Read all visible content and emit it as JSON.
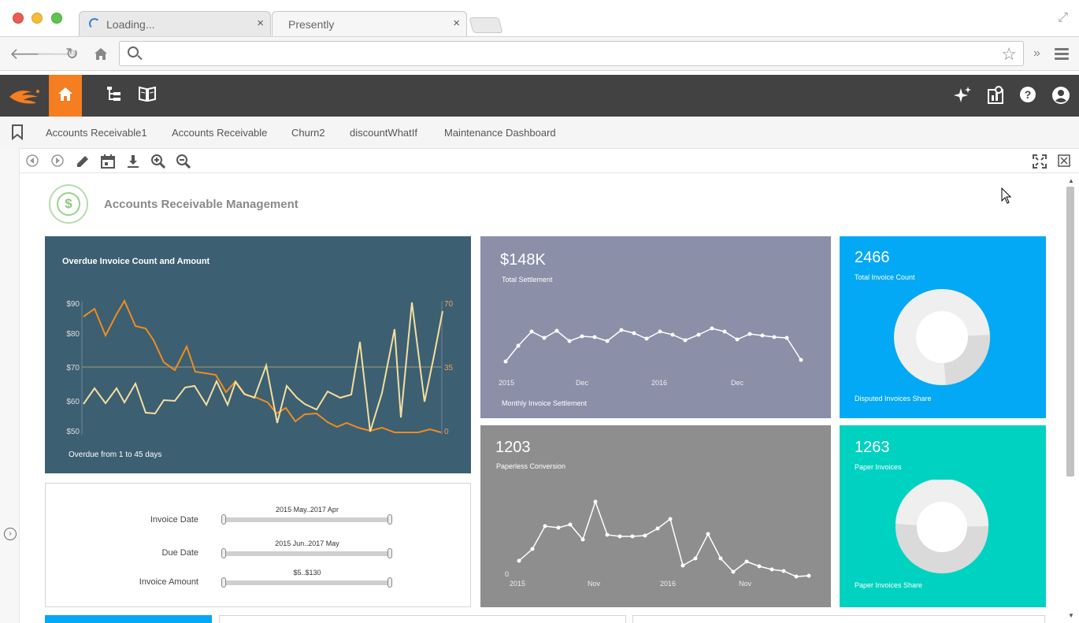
{
  "browser": {
    "tabs": [
      {
        "label": "Loading...",
        "close": "×"
      },
      {
        "label": "Presently",
        "close": "×"
      }
    ],
    "address": "",
    "overflow": "»"
  },
  "app": {
    "accent": "#f47e20",
    "nav_icons": [
      "home-icon",
      "tree-icon",
      "book-icon"
    ],
    "right_icons": [
      "sparkle-icon",
      "stats-icon",
      "help-icon",
      "user-icon"
    ]
  },
  "bookmarks": {
    "items": [
      "Accounts Receivable1",
      "Accounts Receivable",
      "Churn2",
      "discountWhatIf",
      "Maintenance Dashboard"
    ]
  },
  "dashboard": {
    "title": "Accounts Receivable Management",
    "overdue": {
      "title": "Overdue Invoice Count and Amount",
      "subtitle": "Overdue from 1 to 45 days",
      "left_ticks": [
        "$90",
        "$80",
        "$70",
        "$60",
        "$50"
      ],
      "right_ticks": [
        "70",
        "35",
        "0"
      ]
    },
    "settlement": {
      "value": "$148K",
      "label": "Total Settlement",
      "footer": "Monthly Invoice Settlement",
      "x_ticks": [
        "2015",
        "Dec",
        "2016",
        "Dec"
      ]
    },
    "invoice_count": {
      "value": "2466",
      "label": "Total Invoice Count",
      "footer": "Disputed Invoices Share"
    },
    "paperless": {
      "value": "1203",
      "label": "Paperless Conversion",
      "y_tick": "0",
      "x_ticks": [
        "2015",
        "Nov",
        "2016",
        "Nov"
      ]
    },
    "paper": {
      "value": "1263",
      "label": "Paper Invoices",
      "footer": "Paper Invoices Share"
    },
    "filters": [
      {
        "label": "Invoice Date",
        "range": "2015 May..2017 Apr"
      },
      {
        "label": "Due Date",
        "range": "2015 Jun..2017 May"
      },
      {
        "label": "Invoice Amount",
        "range": "$5..$130"
      }
    ]
  }
}
